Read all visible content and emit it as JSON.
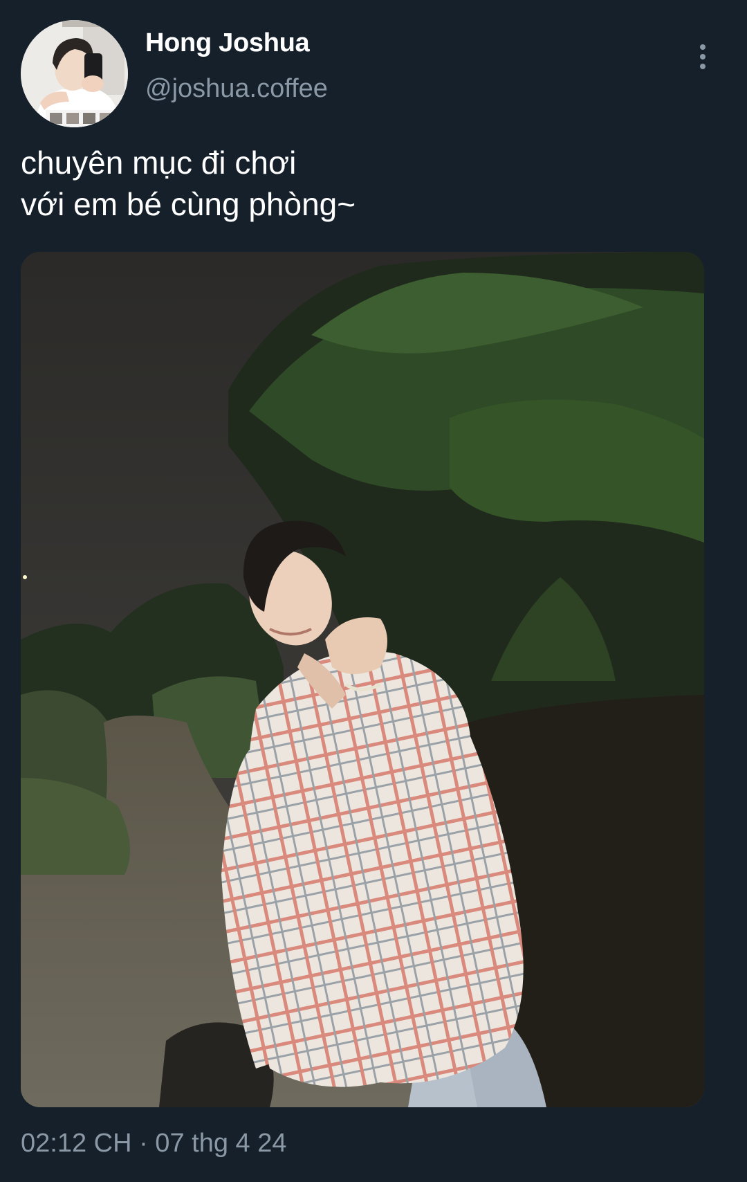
{
  "user": {
    "display_name": "Hong Joshua",
    "handle": "@joshua.coffee",
    "avatar_icon": "profile-photo"
  },
  "tweet": {
    "text": "chuyên mục đi chơi\nvới em bé cùng phòng~",
    "timestamp": "02:12 CH · 07 thg 4 24"
  },
  "menu": {
    "more_icon": "vertical-dots-icon"
  },
  "colors": {
    "background": "#15202b",
    "primary_text": "#ffffff",
    "secondary_text": "#8b98a5"
  }
}
